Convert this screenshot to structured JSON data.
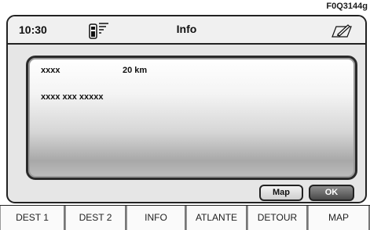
{
  "figure_code": "F0Q3144g",
  "topbar": {
    "time": "10:30",
    "title": "Info",
    "phone_icon": "phone-signal-icon",
    "right_icon": "pen-edit-icon"
  },
  "panel": {
    "line1_name": "xxxx",
    "line1_distance": "20 km",
    "line2": "xxxx xxx xxxxx"
  },
  "buttons": {
    "map": "Map",
    "ok": "OK"
  },
  "softkeys": [
    "DEST 1",
    "DEST 2",
    "INFO",
    "ATLANTE",
    "DETOUR",
    "MAP"
  ]
}
